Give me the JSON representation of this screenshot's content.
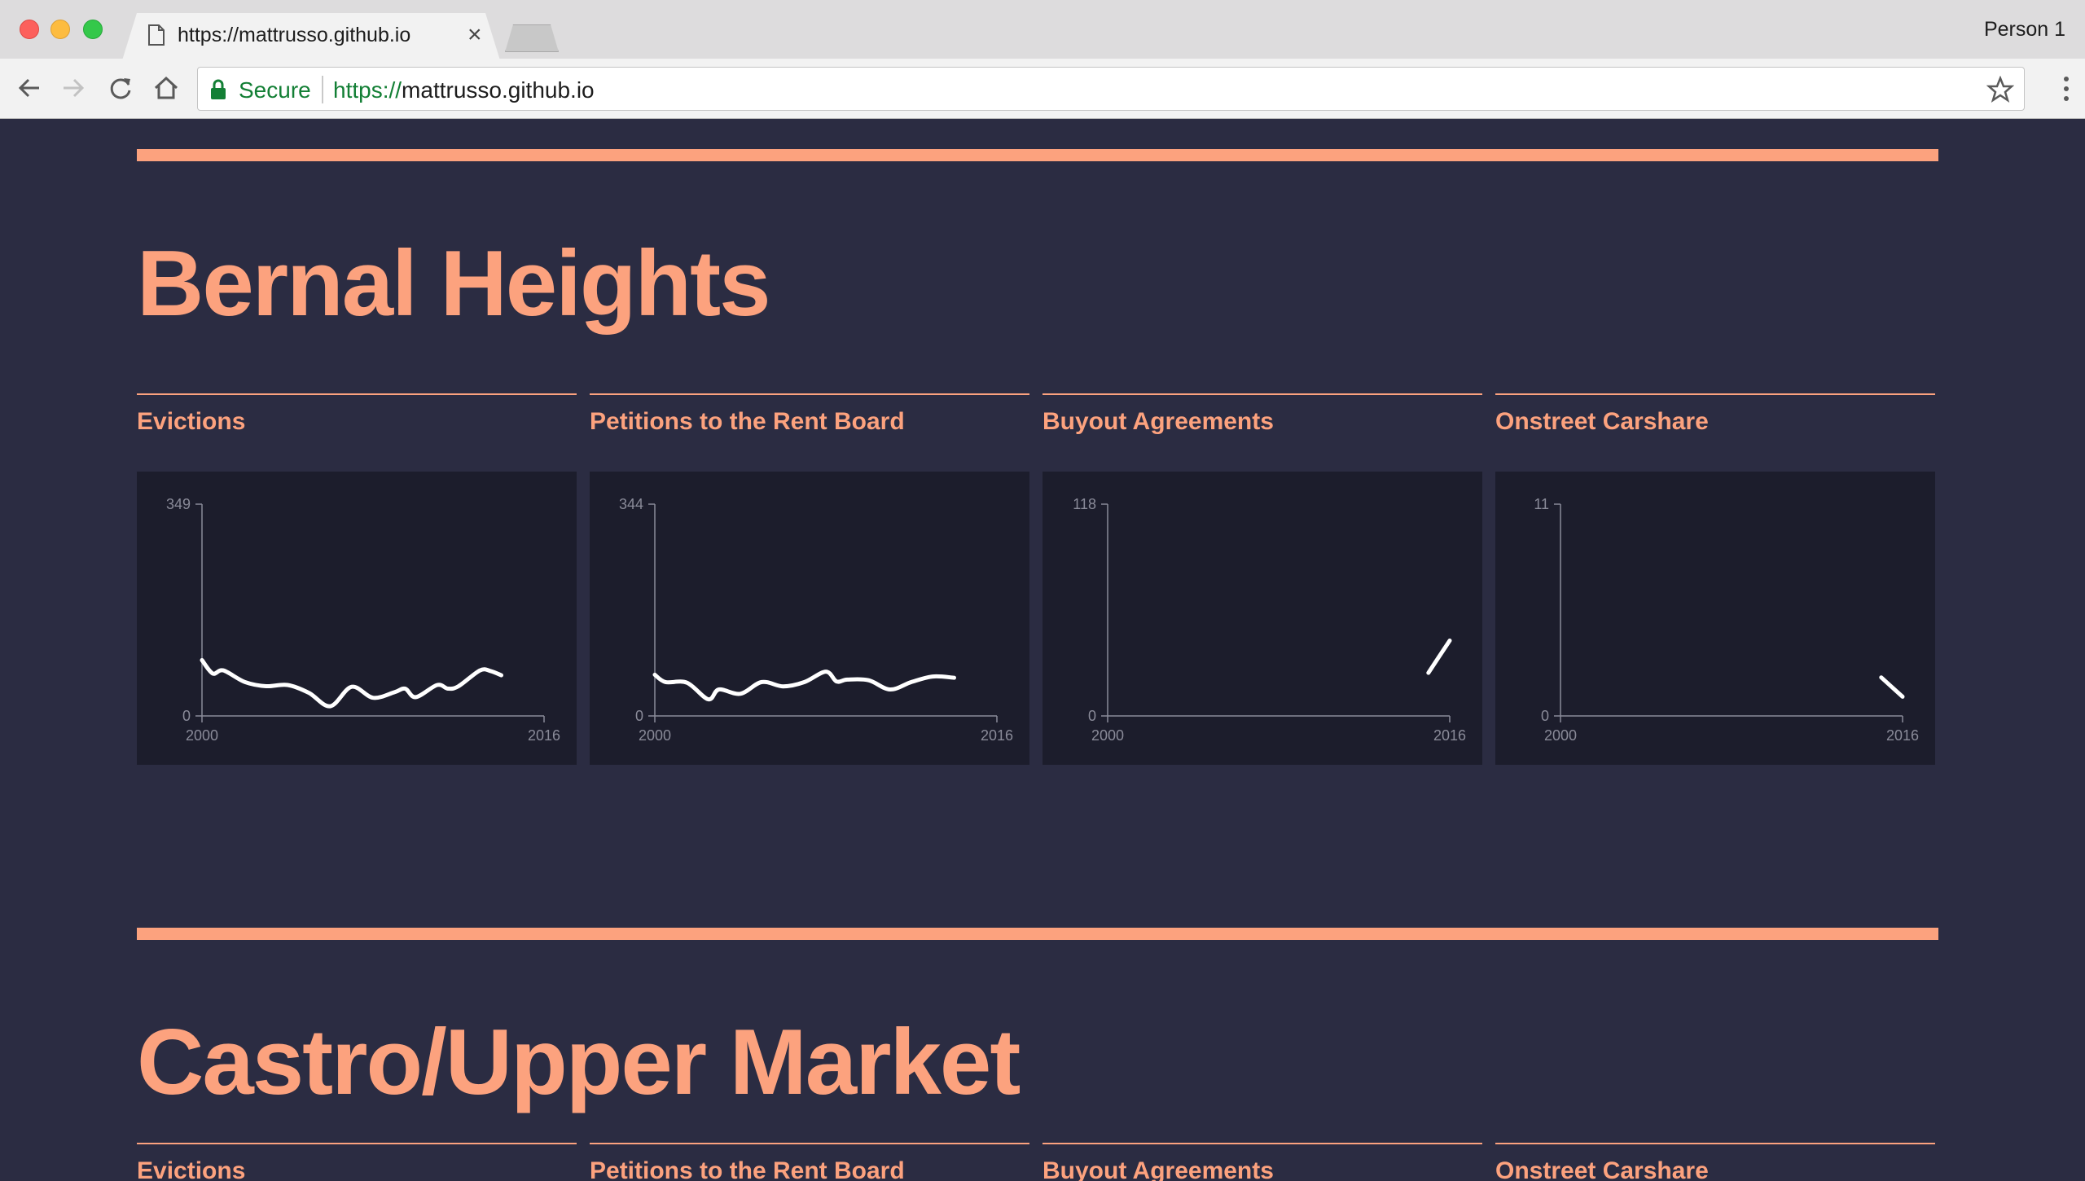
{
  "browser": {
    "tab_title": "https://mattrusso.github.io",
    "tab_close": "×",
    "profile": "Person 1",
    "secure_label": "Secure",
    "url_scheme": "https://",
    "url_host": "mattrusso.github.io"
  },
  "neighborhoods": [
    {
      "name": "Bernal Heights",
      "charts": [
        {
          "label": "Evictions",
          "ymax": 349,
          "yzero": "0",
          "x_start": "2000",
          "x_end": "2016",
          "series_type": "line",
          "series": [
            [
              2000,
              92
            ],
            [
              2000.5,
              70
            ],
            [
              2001,
              75
            ],
            [
              2002,
              56
            ],
            [
              2003,
              49
            ],
            [
              2004,
              51
            ],
            [
              2005,
              38
            ],
            [
              2006,
              16
            ],
            [
              2007,
              48
            ],
            [
              2008,
              30
            ],
            [
              2009,
              39
            ],
            [
              2009.5,
              45
            ],
            [
              2010,
              31
            ],
            [
              2011,
              51
            ],
            [
              2011.5,
              45
            ],
            [
              2012,
              49
            ],
            [
              2013,
              75
            ],
            [
              2013.5,
              74
            ],
            [
              2014,
              67
            ]
          ]
        },
        {
          "label": "Petitions to the Rent Board",
          "ymax": 344,
          "yzero": "0",
          "x_start": "2000",
          "x_end": "2016",
          "series_type": "line",
          "series": [
            [
              2000,
              67
            ],
            [
              2000.5,
              55
            ],
            [
              2001.5,
              54
            ],
            [
              2002.5,
              27
            ],
            [
              2003,
              43
            ],
            [
              2004,
              36
            ],
            [
              2005,
              55
            ],
            [
              2006,
              48
            ],
            [
              2007,
              55
            ],
            [
              2008,
              72
            ],
            [
              2008.5,
              56
            ],
            [
              2009,
              59
            ],
            [
              2010,
              58
            ],
            [
              2011,
              43
            ],
            [
              2012,
              55
            ],
            [
              2013,
              64
            ],
            [
              2014,
              62
            ]
          ]
        },
        {
          "label": "Buyout Agreements",
          "ymax": 118,
          "yzero": "0",
          "x_start": "2000",
          "x_end": "2016",
          "series_type": "segment",
          "series": [
            [
              2015,
              24
            ],
            [
              2016,
              42
            ]
          ]
        },
        {
          "label": "Onstreet Carshare",
          "ymax": 11,
          "yzero": "0",
          "x_start": "2000",
          "x_end": "2016",
          "series_type": "segment",
          "series": [
            [
              2015,
              2
            ],
            [
              2016,
              1
            ]
          ]
        }
      ]
    },
    {
      "name": "Castro/Upper Market",
      "charts": [
        {
          "label": "Evictions"
        },
        {
          "label": "Petitions to the Rent Board"
        },
        {
          "label": "Buyout Agreements"
        },
        {
          "label": "Onstreet Carshare"
        }
      ]
    }
  ],
  "colors": {
    "accent": "#fca27e",
    "background": "#2b2c42",
    "chart_bg": "#1c1d2c",
    "line": "#ffffff",
    "axis": "#8a8b99"
  }
}
